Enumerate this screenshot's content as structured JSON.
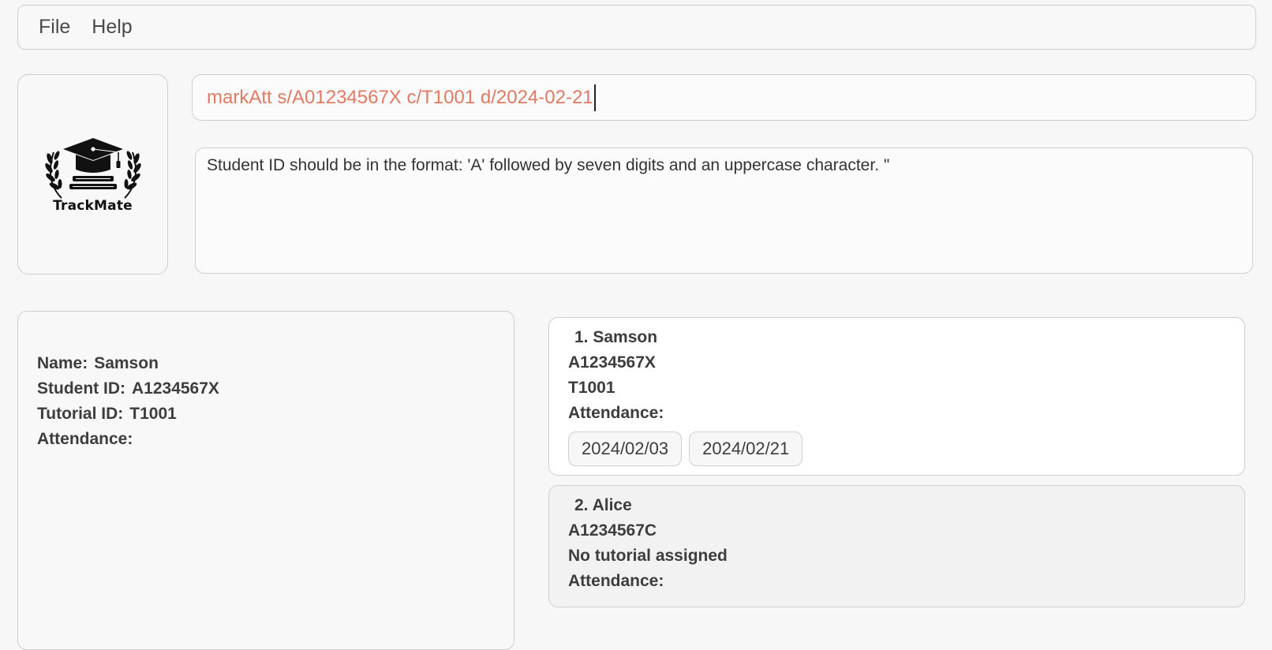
{
  "menu": {
    "items": [
      {
        "label": "File"
      },
      {
        "label": "Help"
      }
    ]
  },
  "logo": {
    "text": "TrackMate",
    "icon": "graduation-cap-laurel-icon"
  },
  "command": {
    "value": "markAtt s/A01234567X c/T1001 d/2024-02-21",
    "color": "#e07a63"
  },
  "result": {
    "message": "Student ID should be in the format: 'A' followed by seven digits and an uppercase character. \""
  },
  "detail": {
    "name_label": "Name:",
    "name": "Samson",
    "student_id_label": "Student ID:",
    "student_id": "A1234567X",
    "tutorial_id_label": "Tutorial ID:",
    "tutorial_id": "T1001",
    "attendance_label": "Attendance:"
  },
  "students": [
    {
      "index_name": "1. Samson",
      "student_id": "A1234567X",
      "tutorial": "T1001",
      "attendance_label": "Attendance:",
      "attendance": [
        "2024/02/03",
        "2024/02/21"
      ]
    },
    {
      "index_name": "2. Alice",
      "student_id": "A1234567C",
      "tutorial": "No tutorial assigned",
      "attendance_label": "Attendance:",
      "attendance": []
    }
  ]
}
